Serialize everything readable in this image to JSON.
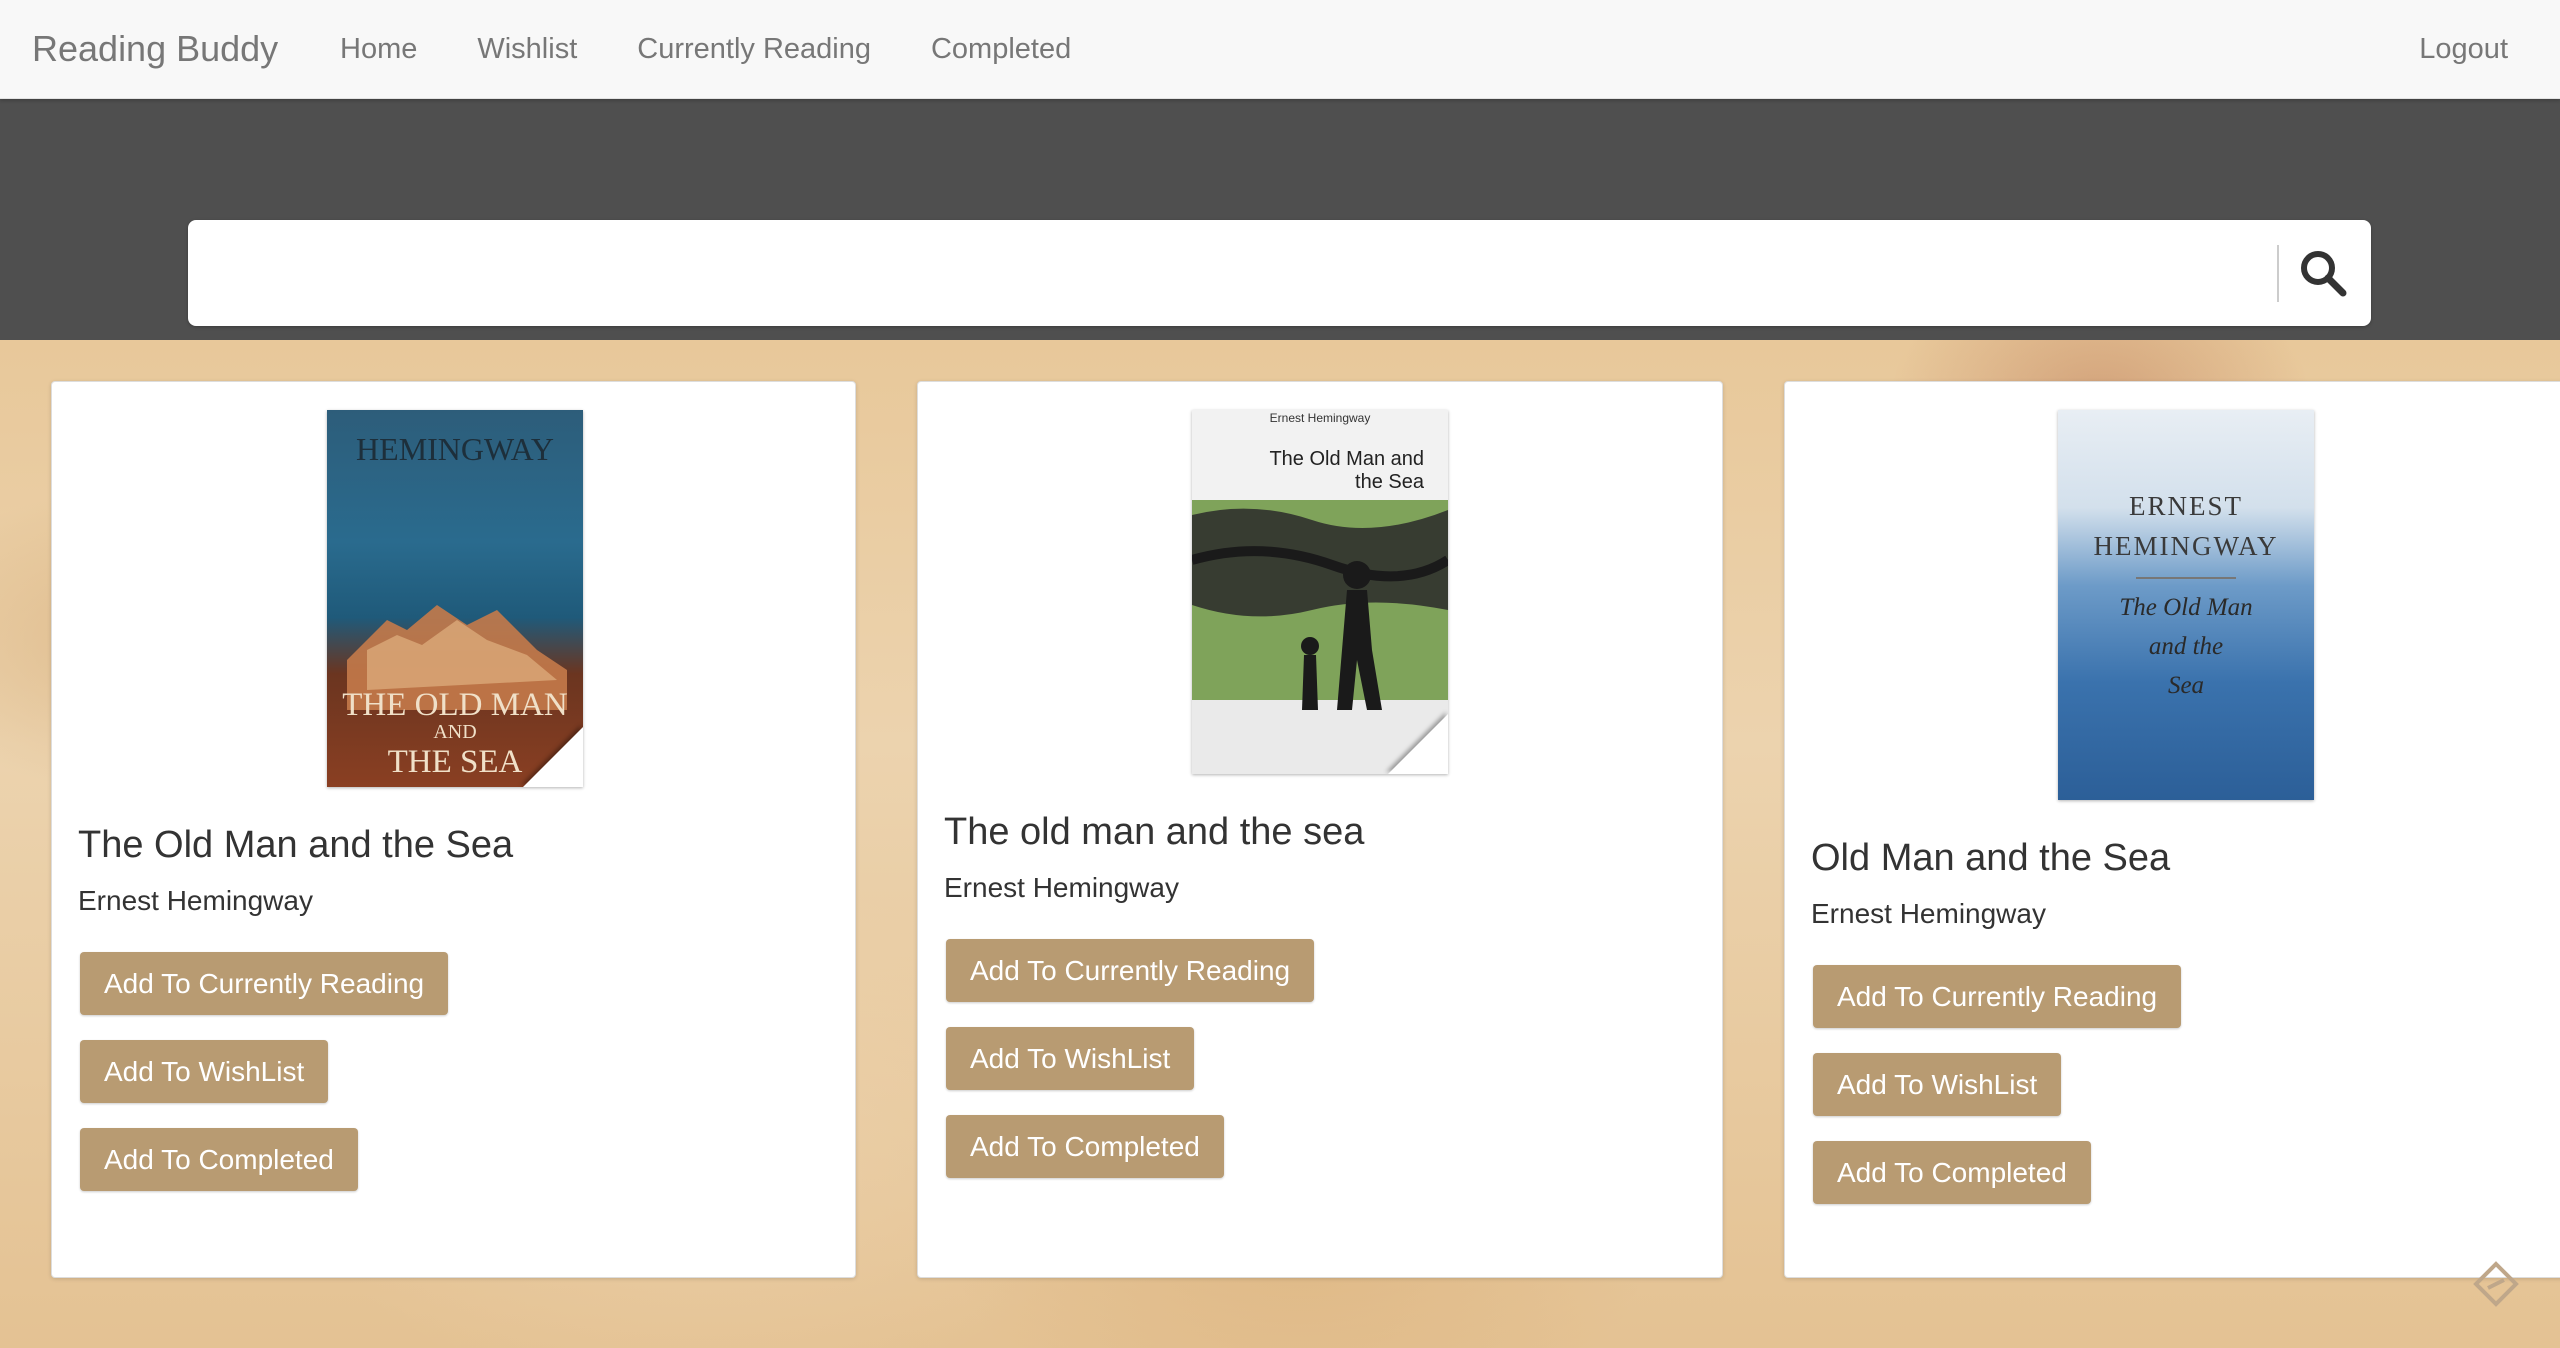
{
  "app": {
    "brand": "Reading Buddy",
    "nav": [
      {
        "label": "Home"
      },
      {
        "label": "Wishlist"
      },
      {
        "label": "Currently Reading"
      },
      {
        "label": "Completed"
      }
    ],
    "logout_label": "Logout"
  },
  "search": {
    "value": "",
    "placeholder": "",
    "icon": "search-icon"
  },
  "colors": {
    "button": "#b89b72",
    "band": "#4f4f4f",
    "navbar": "#f8f8f8"
  },
  "books": [
    {
      "title": "The Old Man and the Sea",
      "author": "Ernest Hemingway",
      "cover": {
        "lines": [
          "HEMINGWAY",
          "THE OLD MAN",
          "AND",
          "THE SEA"
        ]
      },
      "buttons": {
        "current": "Add To Currently Reading",
        "wishlist": "Add To WishList",
        "completed": "Add To Completed"
      }
    },
    {
      "title": "The old man and the sea",
      "author": "Ernest Hemingway",
      "cover": {
        "lines": [
          "Ernest Hemingway",
          "The Old Man and",
          "the Sea"
        ]
      },
      "buttons": {
        "current": "Add To Currently Reading",
        "wishlist": "Add To WishList",
        "completed": "Add To Completed"
      }
    },
    {
      "title": "Old Man and the Sea",
      "author": "Ernest Hemingway",
      "cover": {
        "lines": [
          "ERNEST",
          "HEMINGWAY",
          "The Old Man",
          "and the",
          "Sea"
        ]
      },
      "buttons": {
        "current": "Add To Currently Reading",
        "wishlist": "Add To WishList",
        "completed": "Add To Completed"
      }
    }
  ]
}
